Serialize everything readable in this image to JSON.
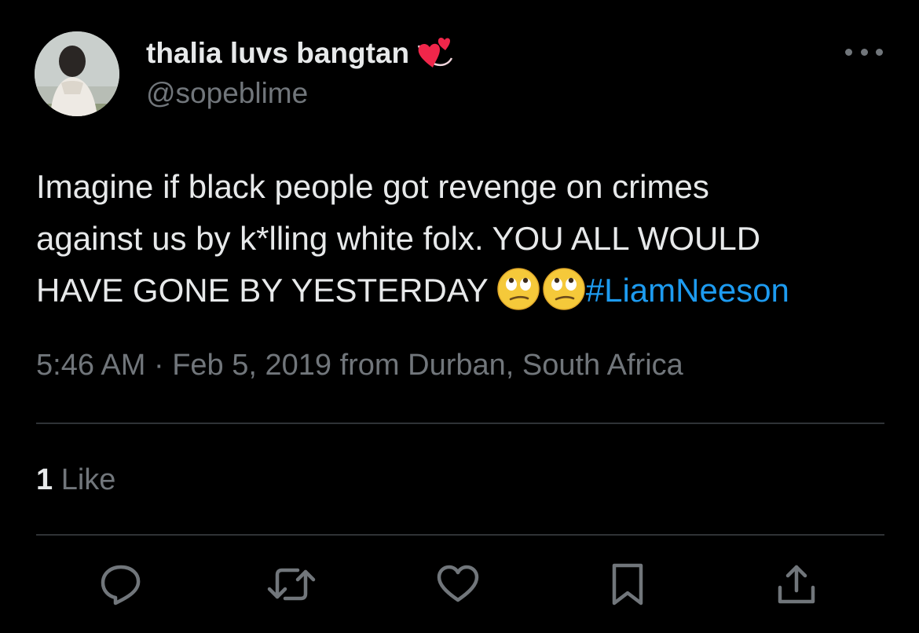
{
  "author": {
    "display_name": "thalia luvs bangtan",
    "name_emoji": "revolving-hearts",
    "handle": "@sopeblime",
    "avatar": "profile-photo"
  },
  "tweet": {
    "lines": [
      "Imagine if black people got revenge on crimes",
      "against us by k*lling white folx. YOU ALL WOULD",
      "HAVE GONE BY YESTERDAY"
    ],
    "emojis": [
      "face-with-rolling-eyes",
      "face-with-rolling-eyes"
    ],
    "hashtag": "#LiamNeeson"
  },
  "meta": {
    "timestamp": "5:46 AM · Feb 5, 2019 from Durban, South Africa"
  },
  "engagement": {
    "like_count": "1",
    "like_label": "Like"
  },
  "actions": {
    "reply_icon": "reply-icon",
    "retweet_icon": "retweet-icon",
    "like_icon": "like-icon",
    "bookmark_icon": "bookmark-icon",
    "share_icon": "share-icon"
  },
  "colors": {
    "background": "#000000",
    "text_primary": "#e7e9ea",
    "text_secondary": "#71767b",
    "accent": "#1d9bf0",
    "divider": "#2f3336"
  }
}
